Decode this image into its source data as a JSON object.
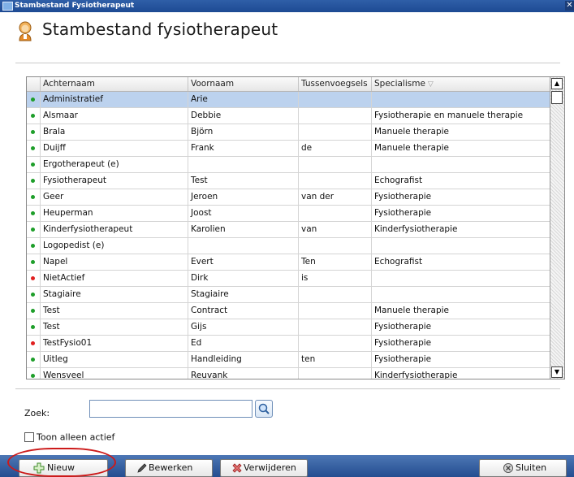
{
  "window": {
    "title": "Stambestand Fysiotherapeut"
  },
  "header": {
    "title": "Stambestand fysiotherapeut"
  },
  "grid": {
    "columns": [
      "Achternaam",
      "Voornaam",
      "Tussenvoegsels",
      "Specialisme"
    ],
    "sort_indicator": "▽",
    "status_colors": {
      "active": "#1e9e2a",
      "inactive": "#e02020"
    },
    "rows": [
      {
        "status": "active",
        "achternaam": "Administratief",
        "voornaam": "Arie",
        "tussenvoegsels": "",
        "specialisme": "",
        "selected": true
      },
      {
        "status": "active",
        "achternaam": "Alsmaar",
        "voornaam": "Debbie",
        "tussenvoegsels": "",
        "specialisme": "Fysiotherapie en manuele therapie"
      },
      {
        "status": "active",
        "achternaam": "Brala",
        "voornaam": "Björn",
        "tussenvoegsels": "",
        "specialisme": "Manuele therapie"
      },
      {
        "status": "active",
        "achternaam": "Duijff",
        "voornaam": "Frank",
        "tussenvoegsels": "de",
        "specialisme": "Manuele therapie"
      },
      {
        "status": "active",
        "achternaam": "Ergotherapeut (e)",
        "voornaam": "",
        "tussenvoegsels": "",
        "specialisme": ""
      },
      {
        "status": "active",
        "achternaam": "Fysiotherapeut",
        "voornaam": "Test",
        "tussenvoegsels": "",
        "specialisme": "Echografist"
      },
      {
        "status": "active",
        "achternaam": "Geer",
        "voornaam": "Jeroen",
        "tussenvoegsels": "van der",
        "specialisme": "Fysiotherapie"
      },
      {
        "status": "active",
        "achternaam": "Heuperman",
        "voornaam": "Joost",
        "tussenvoegsels": "",
        "specialisme": "Fysiotherapie"
      },
      {
        "status": "active",
        "achternaam": "Kinderfysiotherapeut",
        "voornaam": "Karolien",
        "tussenvoegsels": "van",
        "specialisme": "Kinderfysiotherapie"
      },
      {
        "status": "active",
        "achternaam": "Logopedist (e)",
        "voornaam": "",
        "tussenvoegsels": "",
        "specialisme": ""
      },
      {
        "status": "active",
        "achternaam": "Napel",
        "voornaam": "Evert",
        "tussenvoegsels": "Ten",
        "specialisme": "Echografist"
      },
      {
        "status": "inactive",
        "achternaam": "NietActief",
        "voornaam": "Dirk",
        "tussenvoegsels": "is",
        "specialisme": ""
      },
      {
        "status": "active",
        "achternaam": "Stagiaire",
        "voornaam": "Stagiaire",
        "tussenvoegsels": "",
        "specialisme": ""
      },
      {
        "status": "active",
        "achternaam": "Test",
        "voornaam": "Contract",
        "tussenvoegsels": "",
        "specialisme": "Manuele therapie"
      },
      {
        "status": "active",
        "achternaam": "Test",
        "voornaam": "Gijs",
        "tussenvoegsels": "",
        "specialisme": "Fysiotherapie"
      },
      {
        "status": "inactive",
        "achternaam": "TestFysio01",
        "voornaam": "Ed",
        "tussenvoegsels": "",
        "specialisme": "Fysiotherapie"
      },
      {
        "status": "active",
        "achternaam": "Uitleg",
        "voornaam": "Handleiding",
        "tussenvoegsels": "ten",
        "specialisme": "Fysiotherapie"
      },
      {
        "status": "active",
        "achternaam": "Wensveel",
        "voornaam": "Reuvank",
        "tussenvoegsels": "",
        "specialisme": "Kinderfysiotherapie"
      }
    ]
  },
  "search": {
    "label": "Zoek:",
    "value": "",
    "icon": "magnifier-icon"
  },
  "filter": {
    "label": "Toon alleen actief",
    "checked": false
  },
  "toolbar": {
    "new_label": "Nieuw",
    "edit_label": "Bewerken",
    "delete_label": "Verwijderen",
    "close_label": "Sluiten"
  }
}
